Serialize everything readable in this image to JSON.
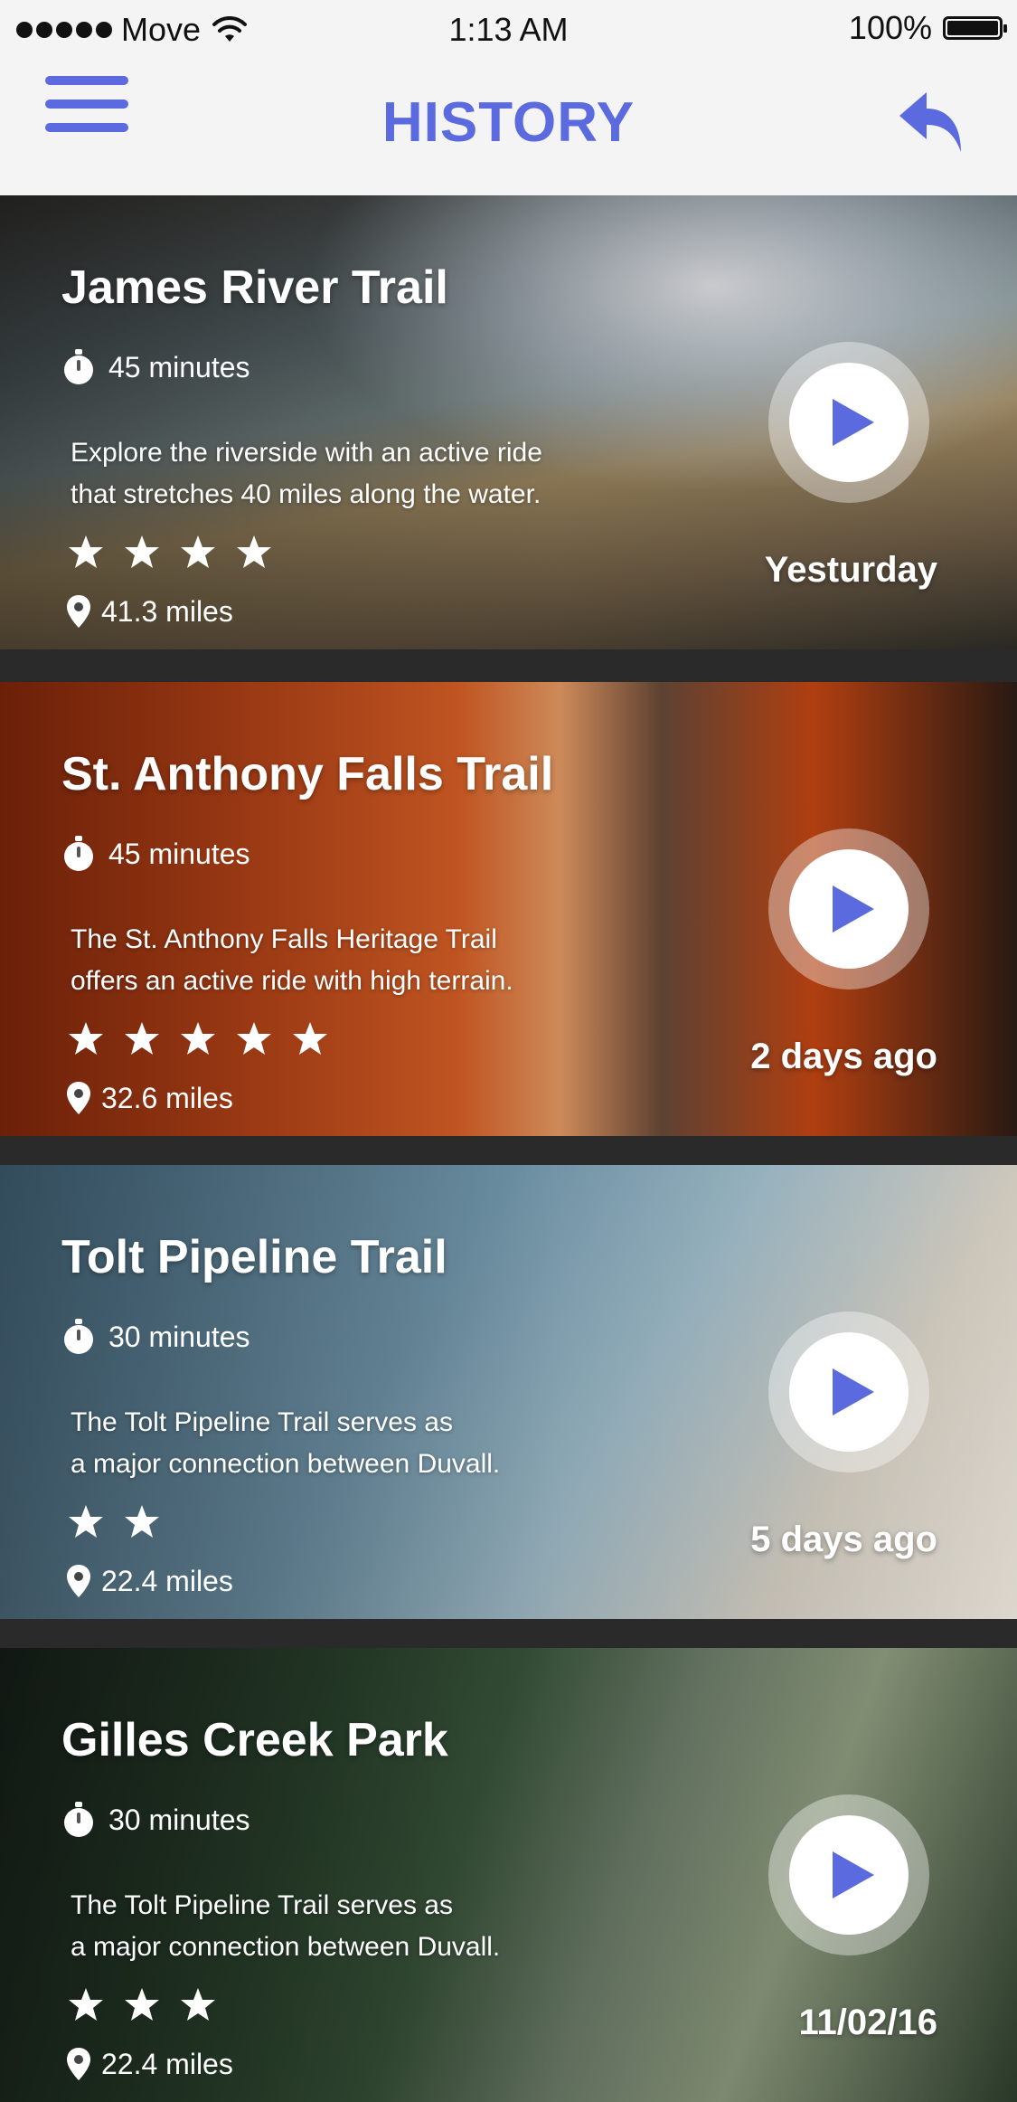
{
  "status_bar": {
    "carrier": "Move",
    "time": "1:13 AM",
    "battery": "100%"
  },
  "header": {
    "title": "HISTORY",
    "accent_color": "#5b6bdf",
    "left_icon": "menu-icon",
    "right_icon": "back-arrow-icon"
  },
  "trails": [
    {
      "title": "James River Trail",
      "duration": "45 minutes",
      "description_line1": "Explore the riverside with an active ride",
      "description_line2": "that stretches 40 miles along the water.",
      "stars": 4,
      "distance": "41.3 miles",
      "date": "Yesturday"
    },
    {
      "title": "St. Anthony Falls Trail",
      "duration": "45 minutes",
      "description_line1": "The St. Anthony Falls Heritage Trail",
      "description_line2": "offers an active ride with high terrain.",
      "stars": 5,
      "distance": "32.6 miles",
      "date": "2 days ago"
    },
    {
      "title": "Tolt Pipeline Trail",
      "duration": "30 minutes",
      "description_line1": "The Tolt Pipeline Trail serves as",
      "description_line2": "a major connection between Duvall.",
      "stars": 2,
      "distance": "22.4 miles",
      "date": "5 days ago"
    },
    {
      "title": "Gilles Creek Park",
      "duration": "30 minutes",
      "description_line1": "The Tolt Pipeline Trail serves as",
      "description_line2": "a major connection between Duvall.",
      "stars": 3,
      "distance": "22.4 miles",
      "date": "11/02/16"
    }
  ]
}
